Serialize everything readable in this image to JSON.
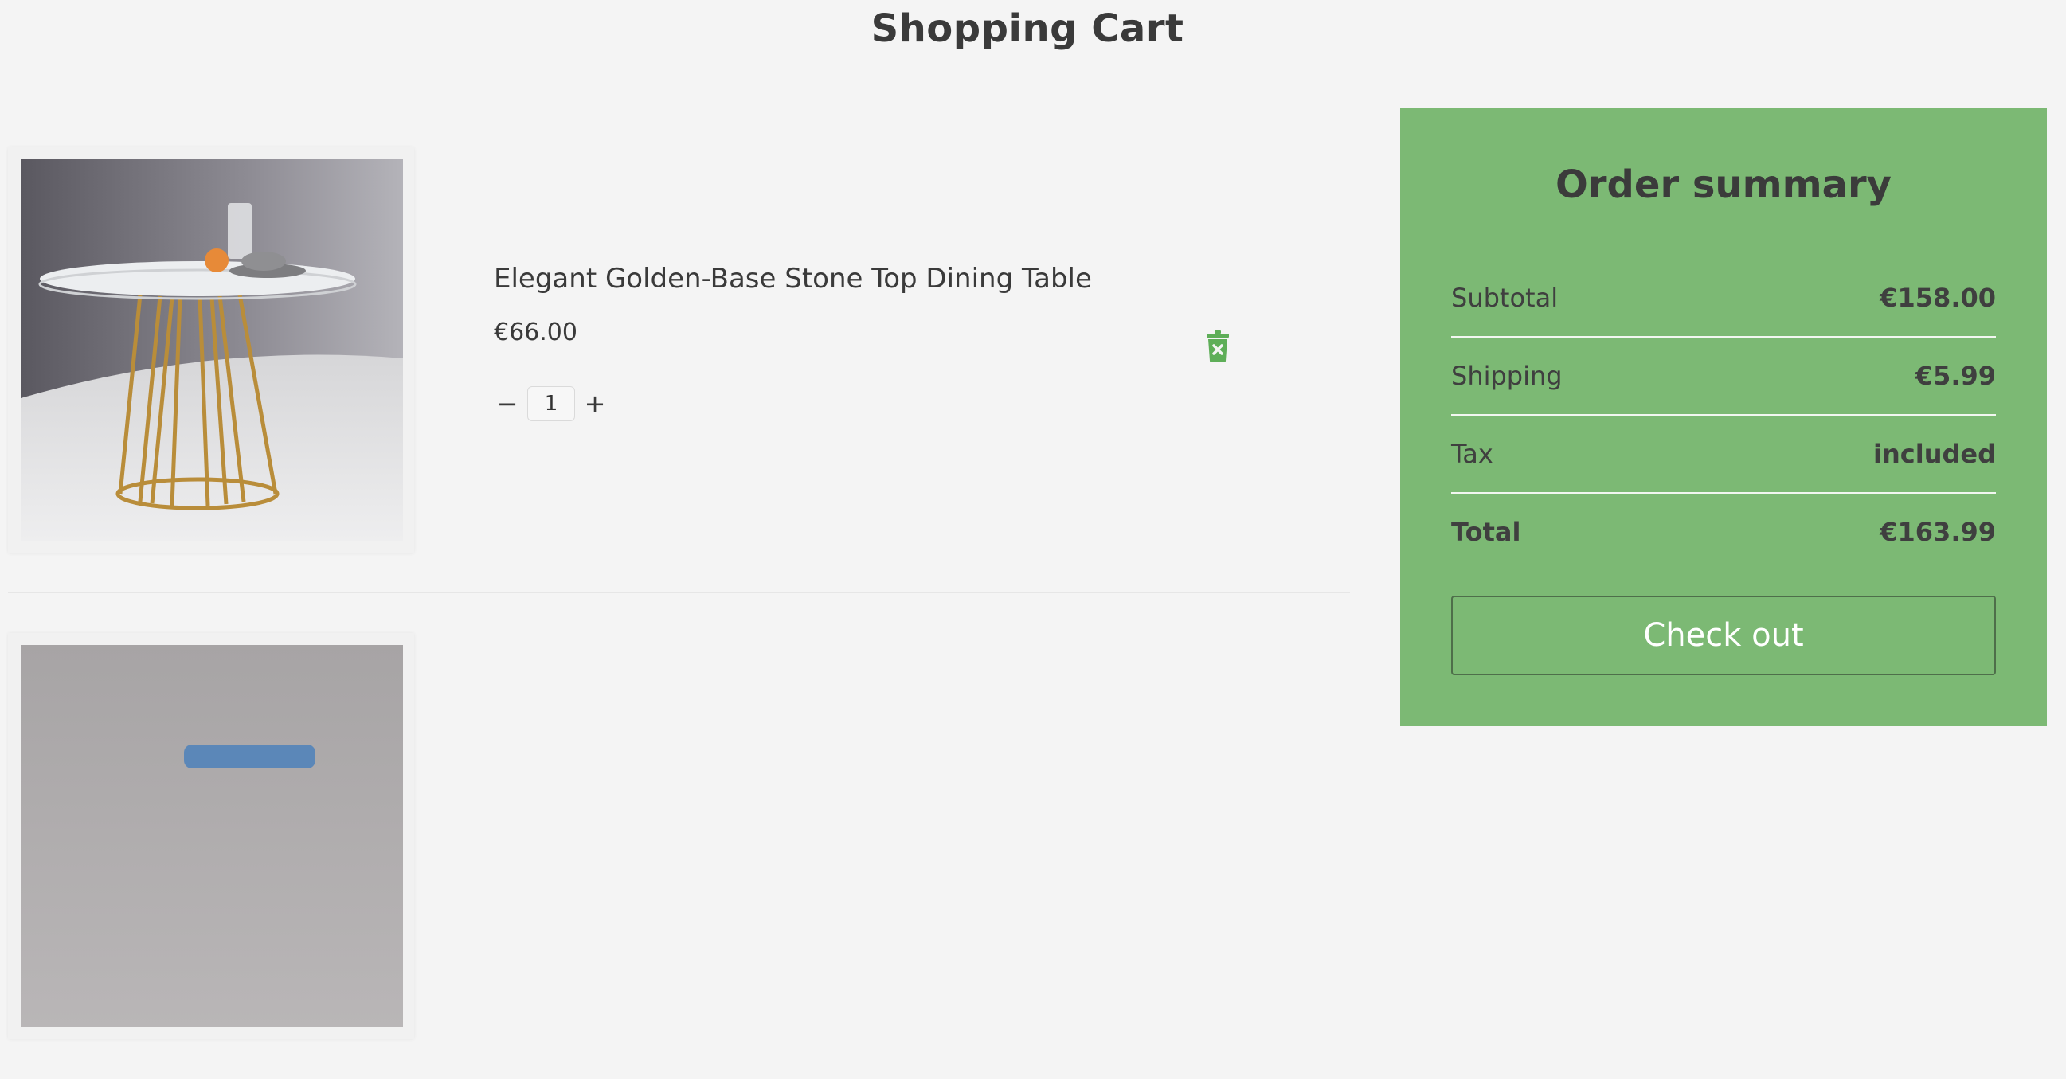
{
  "page": {
    "title": "Shopping Cart"
  },
  "cart": {
    "items": [
      {
        "title": "Elegant Golden-Base Stone Top Dining Table",
        "price": "€66.00",
        "quantity": "1"
      },
      {
        "title": "",
        "price": "",
        "quantity": ""
      }
    ],
    "qty_minus": "−",
    "qty_plus": "+",
    "delete_icon": "trash-x-icon"
  },
  "summary": {
    "title": "Order summary",
    "rows": [
      {
        "label": "Subtotal",
        "value": "€158.00"
      },
      {
        "label": "Shipping",
        "value": "€5.99"
      },
      {
        "label": "Tax",
        "value": "included"
      },
      {
        "label": "Total",
        "value": "€163.99"
      }
    ],
    "checkout_label": "Check out"
  },
  "colors": {
    "accent": "#7cb974",
    "delete_icon": "#5eae58",
    "background": "#f4f4f4"
  }
}
